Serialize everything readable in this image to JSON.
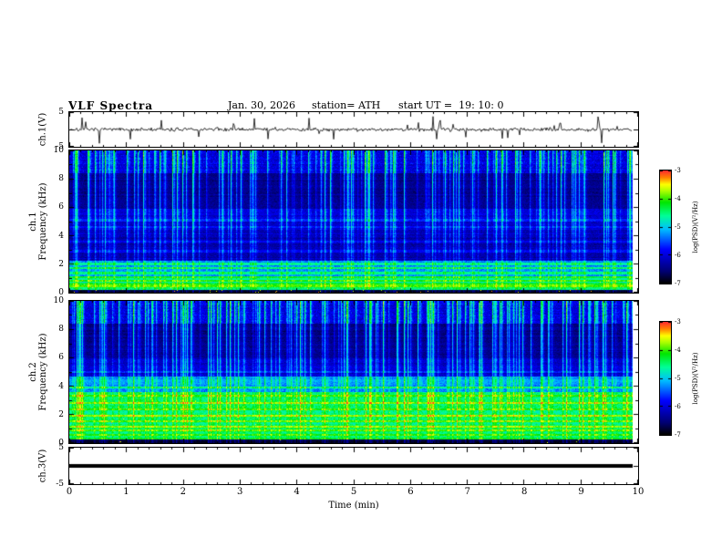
{
  "header": {
    "title": "VLF Spectra",
    "date": "Jan. 30, 2026",
    "station": "station= ATH",
    "start_ut": "start UT =  19: 10: 0"
  },
  "xaxis": {
    "label": "Time (min)",
    "range": [
      0,
      10
    ],
    "ticks": [
      0,
      1,
      2,
      3,
      4,
      5,
      6,
      7,
      8,
      9,
      10
    ],
    "minor_step": 0.2
  },
  "colorbar": {
    "label": "log(PSD)(V²/Hz)",
    "range_top_to_bottom": [
      -3,
      -7
    ],
    "ticks": [
      -3,
      -4,
      -5,
      -6,
      -7
    ]
  },
  "colormap": [
    {
      "t": 0.0,
      "c": "#000000"
    },
    {
      "t": 0.1,
      "c": "#00006e"
    },
    {
      "t": 0.3,
      "c": "#0000ff"
    },
    {
      "t": 0.48,
      "c": "#00beff"
    },
    {
      "t": 0.6,
      "c": "#00ff96"
    },
    {
      "t": 0.72,
      "c": "#00e600"
    },
    {
      "t": 0.82,
      "c": "#aaff00"
    },
    {
      "t": 0.88,
      "c": "#ffff00"
    },
    {
      "t": 0.94,
      "c": "#ff8200"
    },
    {
      "t": 1.0,
      "c": "#ff2d2d"
    }
  ],
  "chart_data": [
    {
      "type": "line",
      "name": "ch1-waveform",
      "ylabel": "ch.1(V)",
      "ylim": [
        -5,
        5
      ],
      "yticks": [
        5,
        -5
      ],
      "xlim": [
        0,
        10
      ],
      "seed": 7,
      "noise_std": 0.5,
      "spike_prob": 0.05,
      "spike_amp": 3.0,
      "line_color": "#000000",
      "description": "Noisy ch.1 voltage trace around 0 V with frequent impulsive spikes up to about ±4 V over 0-10 min"
    },
    {
      "type": "heatmap",
      "name": "ch1-spectrogram",
      "ylabel_line1": "ch.1",
      "ylabel_line2": "Frequency (kHz)",
      "ylim": [
        0,
        10
      ],
      "yticks": [
        0,
        2,
        4,
        6,
        8,
        10
      ],
      "xlim": [
        0,
        10
      ],
      "value_range": [
        -7,
        -3
      ],
      "seed": 21,
      "streak_density": 0.3,
      "speckle_fmax": 0.9,
      "speckle_prob": 0.012,
      "bands": [
        {
          "f0": 8.4,
          "f1": 10.01,
          "level": -6.0,
          "noise": 0.55
        },
        {
          "f0": 5.9,
          "f1": 8.4,
          "level": -6.45,
          "noise": 0.35
        },
        {
          "f0": 4.4,
          "f1": 5.9,
          "level": -6.05,
          "noise": 0.4
        },
        {
          "f0": 2.2,
          "f1": 4.4,
          "level": -6.25,
          "noise": 0.4
        },
        {
          "f0": 1.0,
          "f1": 2.2,
          "level": -5.3,
          "noise": 0.5
        },
        {
          "f0": 0.15,
          "f1": 1.0,
          "level": -4.7,
          "noise": 0.5
        },
        {
          "f0": 0.0,
          "f1": 0.15,
          "level": -6.9,
          "noise": 0.2
        }
      ],
      "lines": [
        {
          "f": 5.1,
          "level": -5.7
        },
        {
          "f": 4.6,
          "level": -5.8
        },
        {
          "f": 3.6,
          "level": -5.9
        },
        {
          "f": 2.9,
          "level": -5.9
        },
        {
          "f": 2.0,
          "level": -4.7
        },
        {
          "f": 1.7,
          "level": -4.5
        },
        {
          "f": 1.35,
          "level": -4.6
        },
        {
          "f": 1.05,
          "level": -4.3
        },
        {
          "f": 0.8,
          "level": -4.1
        },
        {
          "f": 0.6,
          "level": -4.3
        },
        {
          "f": 0.45,
          "level": -4.0
        },
        {
          "f": 0.28,
          "level": -4.5
        }
      ],
      "description": "Dense vertical sferic streaks over blue background 4-10 kHz; bright green/yellow horizontal emission lines below 2 kHz"
    },
    {
      "type": "heatmap",
      "name": "ch2-spectrogram",
      "ylabel_line1": "ch.2",
      "ylabel_line2": "Frequency (kHz)",
      "ylim": [
        0,
        10
      ],
      "yticks": [
        0,
        2,
        4,
        6,
        8,
        10
      ],
      "xlim": [
        0,
        10
      ],
      "value_range": [
        -7,
        -3
      ],
      "seed": 77,
      "streak_density": 0.3,
      "speckle_fmax": 4.0,
      "speckle_prob": 0.004,
      "bands": [
        {
          "f0": 8.4,
          "f1": 10.01,
          "level": -6.0,
          "noise": 0.55
        },
        {
          "f0": 6.0,
          "f1": 8.4,
          "level": -6.45,
          "noise": 0.35
        },
        {
          "f0": 4.7,
          "f1": 6.0,
          "level": -6.1,
          "noise": 0.4
        },
        {
          "f0": 3.6,
          "f1": 4.7,
          "level": -5.3,
          "noise": 0.5
        },
        {
          "f0": 0.2,
          "f1": 3.6,
          "level": -4.55,
          "noise": 0.5
        },
        {
          "f0": 0.0,
          "f1": 0.2,
          "level": -6.9,
          "noise": 0.2
        }
      ],
      "lines": [
        {
          "f": 5.0,
          "level": -5.7
        },
        {
          "f": 4.4,
          "level": -5.2
        },
        {
          "f": 3.9,
          "level": -4.6
        },
        {
          "f": 3.3,
          "level": -4.1
        },
        {
          "f": 2.8,
          "level": -3.9
        },
        {
          "f": 2.35,
          "level": -4.1
        },
        {
          "f": 1.9,
          "level": -3.85
        },
        {
          "f": 1.5,
          "level": -4.0
        },
        {
          "f": 1.15,
          "level": -3.9
        },
        {
          "f": 0.85,
          "level": -4.0
        },
        {
          "f": 0.55,
          "level": -4.1
        },
        {
          "f": 0.3,
          "level": -4.3
        }
      ],
      "description": "Similar sferic streaks above 5 kHz; broad bright green/yellow emission band from 0 to about 4 kHz with red-orange flecks"
    },
    {
      "type": "line",
      "name": "ch3-flatline",
      "ylabel": "ch.3(V)",
      "ylim": [
        -5,
        5
      ],
      "yticks": [
        5,
        -5
      ],
      "xlim": [
        0,
        10
      ],
      "flat_value": 0,
      "line_width": 4,
      "line_color": "#000000",
      "description": "ch.3 voltage is a flat thick line at 0 V (no signal)"
    }
  ]
}
